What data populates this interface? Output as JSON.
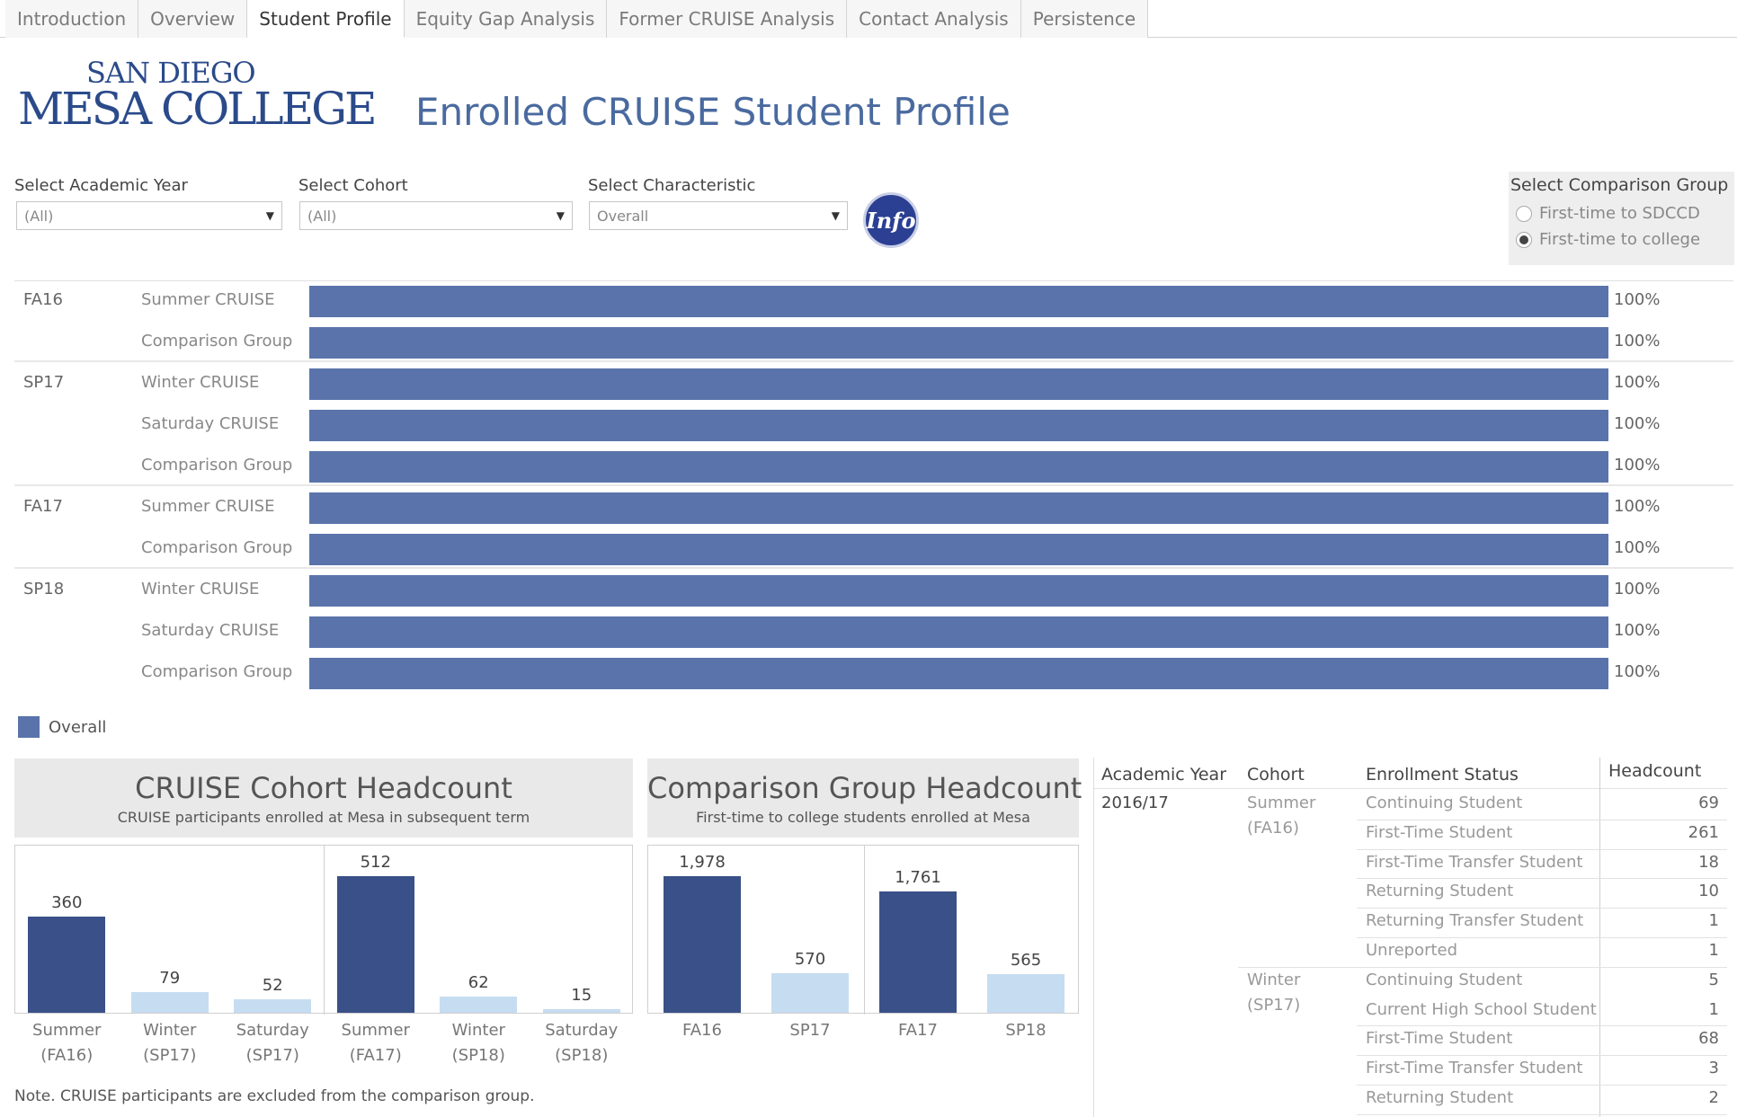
{
  "tabs": [
    "Introduction",
    "Overview",
    "Student Profile",
    "Equity Gap Analysis",
    "Former CRUISE Analysis",
    "Contact Analysis",
    "Persistence"
  ],
  "active_tab": "Student Profile",
  "logo": {
    "line1": "SAN DIEGO",
    "line2": "MESA COLLEGE"
  },
  "title": "Enrolled CRUISE Student Profile",
  "filters": {
    "academic_year": {
      "label": "Select Academic Year",
      "value": "(All)"
    },
    "cohort": {
      "label": "Select Cohort",
      "value": "(All)"
    },
    "characteristic": {
      "label": "Select Characteristic",
      "value": "Overall"
    }
  },
  "info_label": "Info",
  "comparison": {
    "label": "Select Comparison Group",
    "options": [
      "First-time to SDCCD",
      "First-time to college"
    ],
    "selected": "First-time to college"
  },
  "bar_rows": [
    {
      "term": "FA16",
      "group": "Summer CRUISE",
      "pct": "100%",
      "value": 100
    },
    {
      "term": "",
      "group": "Comparison Group",
      "pct": "100%",
      "value": 100
    },
    {
      "term": "SP17",
      "group": "Winter CRUISE",
      "pct": "100%",
      "value": 100
    },
    {
      "term": "",
      "group": "Saturday CRUISE",
      "pct": "100%",
      "value": 100
    },
    {
      "term": "",
      "group": "Comparison Group",
      "pct": "100%",
      "value": 100
    },
    {
      "term": "FA17",
      "group": "Summer CRUISE",
      "pct": "100%",
      "value": 100
    },
    {
      "term": "",
      "group": "Comparison Group",
      "pct": "100%",
      "value": 100
    },
    {
      "term": "SP18",
      "group": "Winter CRUISE",
      "pct": "100%",
      "value": 100
    },
    {
      "term": "",
      "group": "Saturday CRUISE",
      "pct": "100%",
      "value": 100
    },
    {
      "term": "",
      "group": "Comparison Group",
      "pct": "100%",
      "value": 100
    }
  ],
  "legend": {
    "label": "Overall",
    "color": "#5a74ab"
  },
  "cruise_panel": {
    "title": "CRUISE Cohort Headcount",
    "subtitle": "CRUISE participants  enrolled at Mesa in subsequent term"
  },
  "comparison_panel": {
    "title": "Comparison Group Headcount",
    "subtitle": "First-time to college students enrolled at Mesa"
  },
  "chart_data": [
    {
      "type": "bar",
      "title": "CRUISE Cohort Headcount",
      "categories": [
        "Summer (FA16)",
        "Winter (SP17)",
        "Saturday (SP17)",
        "Summer (FA17)",
        "Winter (SP18)",
        "Saturday (SP18)"
      ],
      "values": [
        360,
        79,
        52,
        512,
        62,
        15
      ],
      "labels": [
        "360",
        "79",
        "52",
        "512",
        "62",
        "15"
      ],
      "colors": [
        "#3a5088",
        "#c6dcf0",
        "#c6dcf0",
        "#3a5088",
        "#c6dcf0",
        "#c6dcf0"
      ]
    },
    {
      "type": "bar",
      "title": "Comparison Group Headcount",
      "categories": [
        "FA16",
        "SP17",
        "FA17",
        "SP18"
      ],
      "values": [
        1978,
        570,
        1761,
        565
      ],
      "labels": [
        "1,978",
        "570",
        "1,761",
        "565"
      ],
      "colors": [
        "#3a5088",
        "#c6dcf0",
        "#3a5088",
        "#c6dcf0"
      ]
    }
  ],
  "note": "Note. CRUISE participants are excluded from the comparison group.",
  "table": {
    "headers": [
      "Academic Year",
      "Cohort",
      "Enrollment Status",
      "Headcount"
    ],
    "academic_year": "2016/17",
    "groups": [
      {
        "cohort": [
          "Summer",
          "(FA16)"
        ],
        "rows": [
          {
            "status": "Continuing Student",
            "count": "69"
          },
          {
            "status": "First-Time Student",
            "count": "261"
          },
          {
            "status": "First-Time Transfer Student",
            "count": "18"
          },
          {
            "status": "Returning Student",
            "count": "10"
          },
          {
            "status": "Returning Transfer Student",
            "count": "1"
          },
          {
            "status": "Unreported",
            "count": "1"
          }
        ]
      },
      {
        "cohort": [
          "Winter",
          "(SP17)"
        ],
        "rows": [
          {
            "status": "Continuing Student",
            "count": "5"
          },
          {
            "status": "Current High School Student",
            "count": "1"
          },
          {
            "status": "First-Time Student",
            "count": "68"
          },
          {
            "status": "First-Time Transfer Student",
            "count": "3"
          },
          {
            "status": "Returning Student",
            "count": "2"
          }
        ]
      }
    ]
  }
}
